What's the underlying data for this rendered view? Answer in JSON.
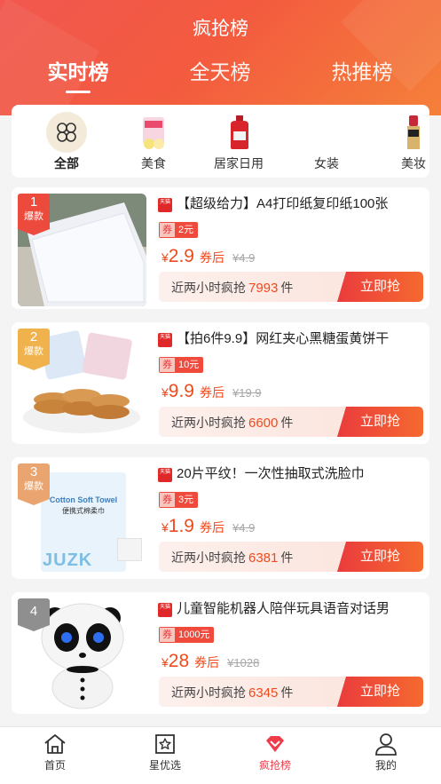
{
  "header": {
    "title": "疯抢榜",
    "tabs": [
      {
        "label": "实时榜",
        "active": true
      },
      {
        "label": "全天榜",
        "active": false
      },
      {
        "label": "热推榜",
        "active": false
      }
    ]
  },
  "categories": [
    {
      "label": "全部",
      "icon": "clover-icon",
      "active": true
    },
    {
      "label": "美食",
      "icon": "snack-icon"
    },
    {
      "label": "居家日用",
      "icon": "detergent-icon"
    },
    {
      "label": "女装",
      "icon": "dress-icon"
    },
    {
      "label": "美妆",
      "icon": "lipstick-icon"
    }
  ],
  "items": [
    {
      "rank": "1",
      "tag": "爆款",
      "store_badge": "天猫",
      "title": "【超级给力】A4打印纸复印纸100张",
      "coupon_label": "券",
      "coupon_value": "2元",
      "currency": "¥",
      "price": "2.9",
      "price_suffix": "券后",
      "original_price": "¥4.9",
      "sales_prefix": "近两小时疯抢",
      "sales_count": "7993",
      "sales_unit": "件",
      "buy_label": "立即抢"
    },
    {
      "rank": "2",
      "tag": "爆款",
      "store_badge": "天猫",
      "title": "【拍6件9.9】网红夹心黑糖蛋黄饼干",
      "coupon_label": "券",
      "coupon_value": "10元",
      "currency": "¥",
      "price": "9.9",
      "price_suffix": "券后",
      "original_price": "¥19.9",
      "sales_prefix": "近两小时疯抢",
      "sales_count": "6600",
      "sales_unit": "件",
      "buy_label": "立即抢"
    },
    {
      "rank": "3",
      "tag": "爆款",
      "store_badge": "天猫",
      "title": "20片平纹！一次性抽取式洗脸巾",
      "coupon_label": "券",
      "coupon_value": "3元",
      "currency": "¥",
      "price": "1.9",
      "price_suffix": "券后",
      "original_price": "¥4.9",
      "sales_prefix": "近两小时疯抢",
      "sales_count": "6381",
      "sales_unit": "件",
      "buy_label": "立即抢",
      "thumb_text": "Cotton Soft Towel",
      "thumb_sub": "便携式棉柔巾",
      "thumb_brand": "JUZK"
    },
    {
      "rank": "4",
      "tag": "",
      "store_badge": "天猫",
      "title": "儿童智能机器人陪伴玩具语音对话男",
      "coupon_label": "券",
      "coupon_value": "1000元",
      "currency": "¥",
      "price": "28",
      "price_suffix": "券后",
      "original_price": "¥1028",
      "sales_prefix": "近两小时疯抢",
      "sales_count": "6345",
      "sales_unit": "件",
      "buy_label": "立即抢"
    }
  ],
  "tabbar": [
    {
      "label": "首页",
      "icon": "home-icon"
    },
    {
      "label": "星优选",
      "icon": "star-icon"
    },
    {
      "label": "疯抢榜",
      "icon": "diamond-icon",
      "active": true
    },
    {
      "label": "我的",
      "icon": "user-icon"
    }
  ]
}
